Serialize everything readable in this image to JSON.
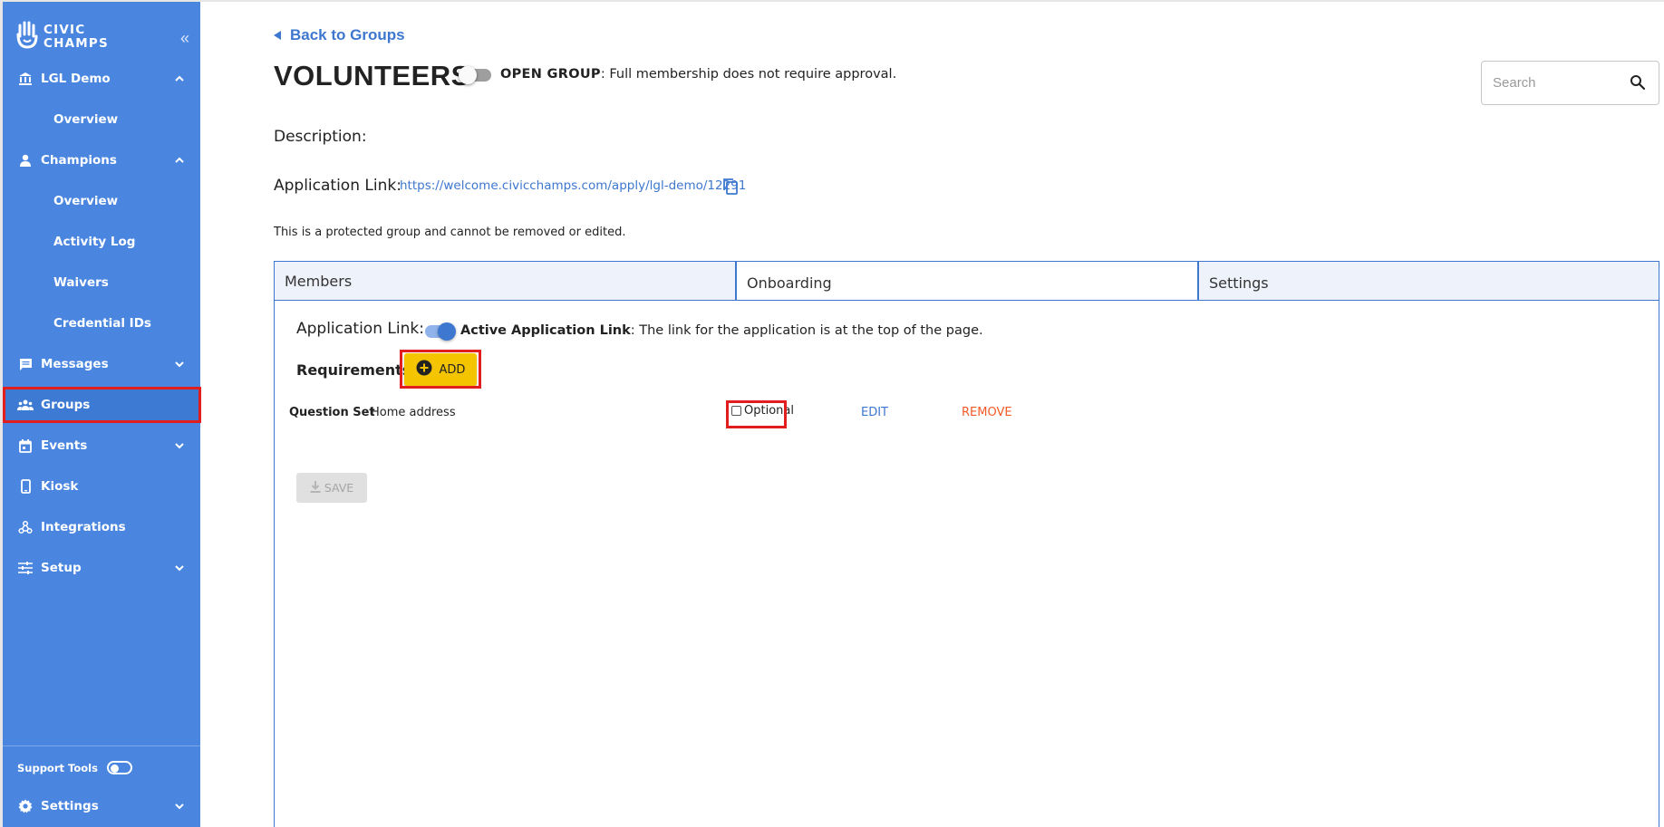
{
  "sidebar": {
    "logo_line1": "CIVIC",
    "logo_line2": "CHAMPS",
    "org": {
      "label": "LGL Demo",
      "items": [
        {
          "label": "Overview"
        }
      ]
    },
    "champions": {
      "label": "Champions",
      "items": [
        {
          "label": "Overview"
        },
        {
          "label": "Activity Log"
        },
        {
          "label": "Waivers"
        },
        {
          "label": "Credential IDs"
        }
      ]
    },
    "messages": {
      "label": "Messages"
    },
    "groups": {
      "label": "Groups"
    },
    "events": {
      "label": "Events"
    },
    "kiosk": {
      "label": "Kiosk"
    },
    "integrations": {
      "label": "Integrations"
    },
    "setup": {
      "label": "Setup"
    },
    "support_tools": {
      "label": "Support Tools",
      "enabled": false
    },
    "settings": {
      "label": "Settings"
    },
    "colors": {
      "background": "#4a86e0",
      "active": "#3d7ad4",
      "highlight": "#e11d1d"
    }
  },
  "header": {
    "back_label": "Back to Groups",
    "title": "VOLUNTEERS",
    "open_group_toggle": false,
    "open_group_label": "OPEN GROUP",
    "open_group_desc": ": Full membership does not require approval.",
    "search_placeholder": "Search"
  },
  "details": {
    "description_label": "Description:",
    "application_link_label": "Application Link:",
    "application_link_url": "https://welcome.civicchamps.com/apply/lgl-demo/12291",
    "protected_note": "This is a protected group and cannot be removed or edited."
  },
  "tabs": [
    {
      "label": "Members",
      "active": false
    },
    {
      "label": "Onboarding",
      "active": true
    },
    {
      "label": "Settings",
      "active": false
    }
  ],
  "onboarding": {
    "application_link_label": "Application Link:",
    "active_toggle": true,
    "active_label": "Active Application Link",
    "active_desc": ": The link for the application is at the top of the page.",
    "requirements_label": "Requirements:",
    "add_label": "ADD",
    "requirements": [
      {
        "type": "Question Set",
        "name": "Home address",
        "optional_label": "Optional",
        "optional": false,
        "edit_label": "EDIT",
        "remove_label": "REMOVE"
      }
    ],
    "save_label": "SAVE"
  },
  "colors": {
    "accent": "#3d77cf",
    "add_button": "#f5c400",
    "remove": "#f05a28",
    "highlight": "#e11d1d"
  }
}
